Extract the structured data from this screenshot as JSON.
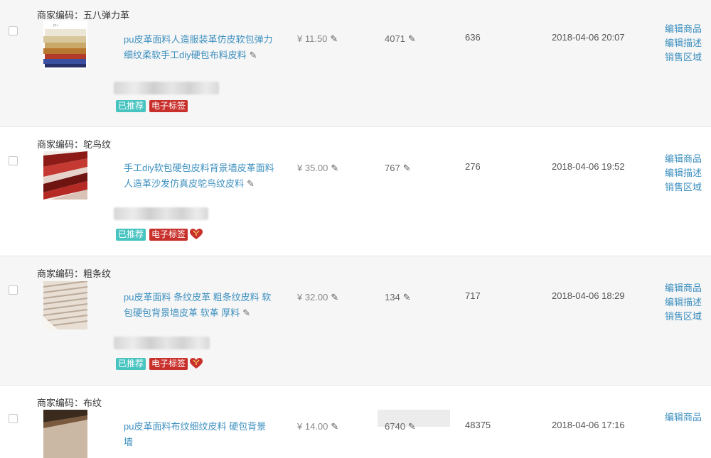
{
  "rows": [
    {
      "merchant_code": "商家编码：五八弹力革",
      "title": "pu皮革面料人造服装革仿皮软包弹力细纹柔软手工diy硬包布料皮料",
      "price": "¥ 11.50",
      "stock": "4071",
      "sold": "636",
      "date": "2018-04-06 20:07",
      "tags": [
        "已推荐",
        "电子标签"
      ],
      "has_heart": false,
      "thumb_icon": "leather-swatch-multicolor-thumb",
      "thumb_colors": [
        "#e9e3d3",
        "#c9a86a",
        "#b23a2a",
        "#3b4fa0",
        "#d9c89c"
      ],
      "actions": [
        "编辑商品",
        "编辑描述",
        "销售区域"
      ]
    },
    {
      "merchant_code": "商家编码：鸵鸟纹",
      "title": "手工diy软包硬包皮料背景墙皮革面料人造革沙发仿真皮鸵鸟纹皮料",
      "price": "¥ 35.00",
      "stock": "767",
      "sold": "276",
      "date": "2018-04-06 19:52",
      "tags": [
        "已推荐",
        "电子标签"
      ],
      "has_heart": true,
      "thumb_icon": "ostrich-leather-red-thumb",
      "thumb_colors": [
        "#8c1a17",
        "#c43a33",
        "#e6d4cc",
        "#6e1411",
        "#b52a25"
      ],
      "actions": [
        "编辑商品",
        "编辑描述",
        "销售区域"
      ]
    },
    {
      "merchant_code": "商家编码：粗条纹",
      "title": "pu皮革面料 条纹皮革 粗条纹皮料 软包硬包背景墙皮革 软革 厚料",
      "price": "¥ 32.00",
      "stock": "134",
      "sold": "717",
      "date": "2018-04-06 18:29",
      "tags": [
        "已推荐",
        "电子标签"
      ],
      "has_heart": true,
      "thumb_icon": "striped-leather-thumb",
      "thumb_colors": [
        "#cfc2b6",
        "#e8ded4",
        "#b9a999",
        "#f2ebe4"
      ],
      "actions": [
        "编辑商品",
        "编辑描述",
        "销售区域"
      ]
    },
    {
      "merchant_code": "商家编码：布纹",
      "title": "pu皮革面料布纹细纹皮料 硬包背景墙",
      "price": "¥ 14.00",
      "stock": "6740",
      "sold": "48375",
      "date": "2018-04-06 17:16",
      "tags": [],
      "has_heart": false,
      "thumb_icon": "cloth-grain-leather-thumb",
      "thumb_colors": [
        "#7a5a3e",
        "#cbb8a4",
        "#3b2a1e"
      ],
      "actions": [
        "编辑商品"
      ]
    }
  ]
}
